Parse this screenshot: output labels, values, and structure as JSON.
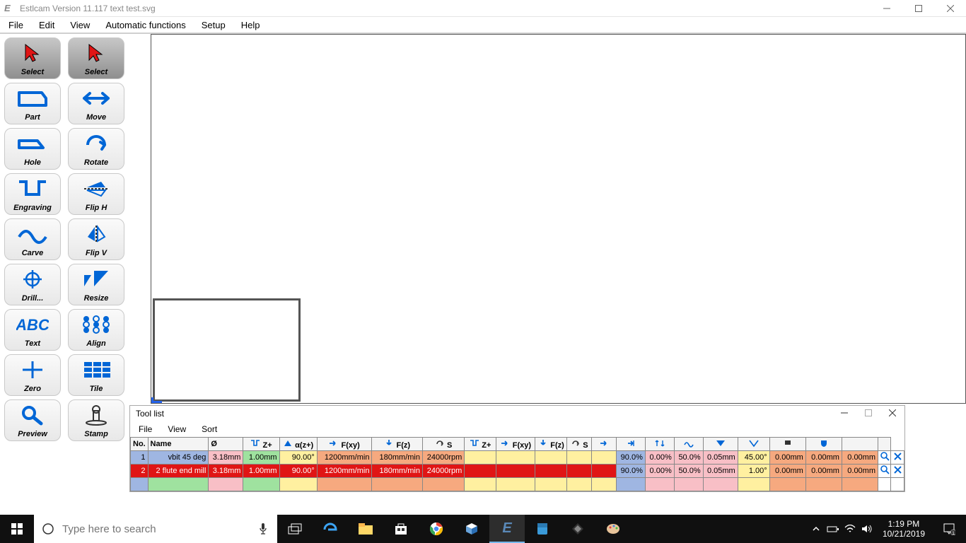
{
  "window": {
    "title": "Estlcam Version 11.117 text test.svg"
  },
  "menu": {
    "file": "File",
    "edit": "Edit",
    "view": "View",
    "auto": "Automatic functions",
    "setup": "Setup",
    "help": "Help"
  },
  "tools_left": [
    {
      "id": "select",
      "label": "Select"
    },
    {
      "id": "part",
      "label": "Part"
    },
    {
      "id": "hole",
      "label": "Hole"
    },
    {
      "id": "engraving",
      "label": "Engraving"
    },
    {
      "id": "carve",
      "label": "Carve"
    },
    {
      "id": "drill",
      "label": "Drill..."
    },
    {
      "id": "text",
      "label": "Text"
    },
    {
      "id": "zero",
      "label": "Zero"
    },
    {
      "id": "preview",
      "label": "Preview"
    }
  ],
  "tools_right": [
    {
      "id": "select2",
      "label": "Select"
    },
    {
      "id": "move",
      "label": "Move"
    },
    {
      "id": "rotate",
      "label": "Rotate"
    },
    {
      "id": "fliph",
      "label": "Flip H"
    },
    {
      "id": "flipv",
      "label": "Flip V"
    },
    {
      "id": "resize",
      "label": "Resize"
    },
    {
      "id": "align",
      "label": "Align"
    },
    {
      "id": "tile",
      "label": "Tile"
    },
    {
      "id": "stamp",
      "label": "Stamp"
    }
  ],
  "tool_list": {
    "title": "Tool list",
    "menu": {
      "file": "File",
      "view": "View",
      "sort": "Sort"
    },
    "headers": {
      "no": "No.",
      "name": "Name",
      "dia": "Ø",
      "zplus": "Z+",
      "angle": "α(z+)",
      "fxy": "F(xy)",
      "fz": "F(z)",
      "s": "S",
      "zplus2": "Z+",
      "fxy2": "F(xy)",
      "fz2": "F(z)",
      "s2": "S"
    },
    "rows": [
      {
        "no": "1",
        "name": "vbit 45 deg",
        "dia": "3.18mm",
        "z": "1.00mm",
        "ang": "90.00°",
        "fxy": "1200mm/min",
        "fz": "180mm/min",
        "s": "24000rpm",
        "p1": "90.0%",
        "p2": "0.00%",
        "p3": "50.0%",
        "p4": "0.05mm",
        "p5": "45.00°",
        "p6": "0.00mm",
        "p7": "0.00mm",
        "p8": "0.00mm",
        "bg_no": "#9fb6e2",
        "bg_name": "#9fb6e2",
        "bg_dia": "#f8bfc6",
        "bg_z": "#9fe29f",
        "bg_ang": "#fff0a0",
        "bg_fxy": "#f6a97f",
        "bg_fz": "#f6a97f",
        "bg_s": "#f6a97f",
        "bg_e1": "#fff0a0",
        "bg_e2": "#fff0a0",
        "bg_e3": "#fff0a0",
        "bg_e4": "#fff0a0",
        "bg_e5": "#fff0a0",
        "bg_p1": "#9fb6e2",
        "bg_p2": "#f8bfc6",
        "bg_p3": "#f8bfc6",
        "bg_p4": "#f8bfc6",
        "bg_p5": "#fff0a0",
        "bg_p6": "#f6a97f",
        "bg_p7": "#f6a97f",
        "bg_p8": "#f6a97f"
      },
      {
        "no": "2",
        "name": "2 flute end mill",
        "dia": "3.18mm",
        "z": "1.00mm",
        "ang": "90.00°",
        "fxy": "1200mm/min",
        "fz": "180mm/min",
        "s": "24000rpm",
        "p1": "90.0%",
        "p2": "0.00%",
        "p3": "50.0%",
        "p4": "0.05mm",
        "p5": "1.00°",
        "p6": "0.00mm",
        "p7": "0.00mm",
        "p8": "0.00mm",
        "bg": "#e01515",
        "fg": "#ffffff",
        "bg_p1": "#9fb6e2",
        "bg_p2": "#f8bfc6",
        "bg_p3": "#f8bfc6",
        "bg_p4": "#f8bfc6",
        "bg_p5": "#fff0a0",
        "bg_p6": "#f6a97f",
        "bg_p7": "#f6a97f",
        "bg_p8": "#f6a97f"
      }
    ],
    "empty_row_bg": [
      "#9fb6e2",
      "#9fe29f",
      "#f8bfc6",
      "#9fe29f",
      "#fff0a0",
      "#f6a97f",
      "#f6a97f",
      "#f6a97f",
      "#fff0a0",
      "#fff0a0",
      "#fff0a0",
      "#fff0a0",
      "#fff0a0",
      "#9fb6e2",
      "#f8bfc6",
      "#f8bfc6",
      "#f8bfc6",
      "#fff0a0",
      "#f6a97f",
      "#f6a97f",
      "#f6a97f",
      "#ffffff",
      "#ffffff"
    ]
  },
  "taskbar": {
    "search_placeholder": "Type here to search",
    "time": "1:19 PM",
    "date": "10/21/2019"
  }
}
